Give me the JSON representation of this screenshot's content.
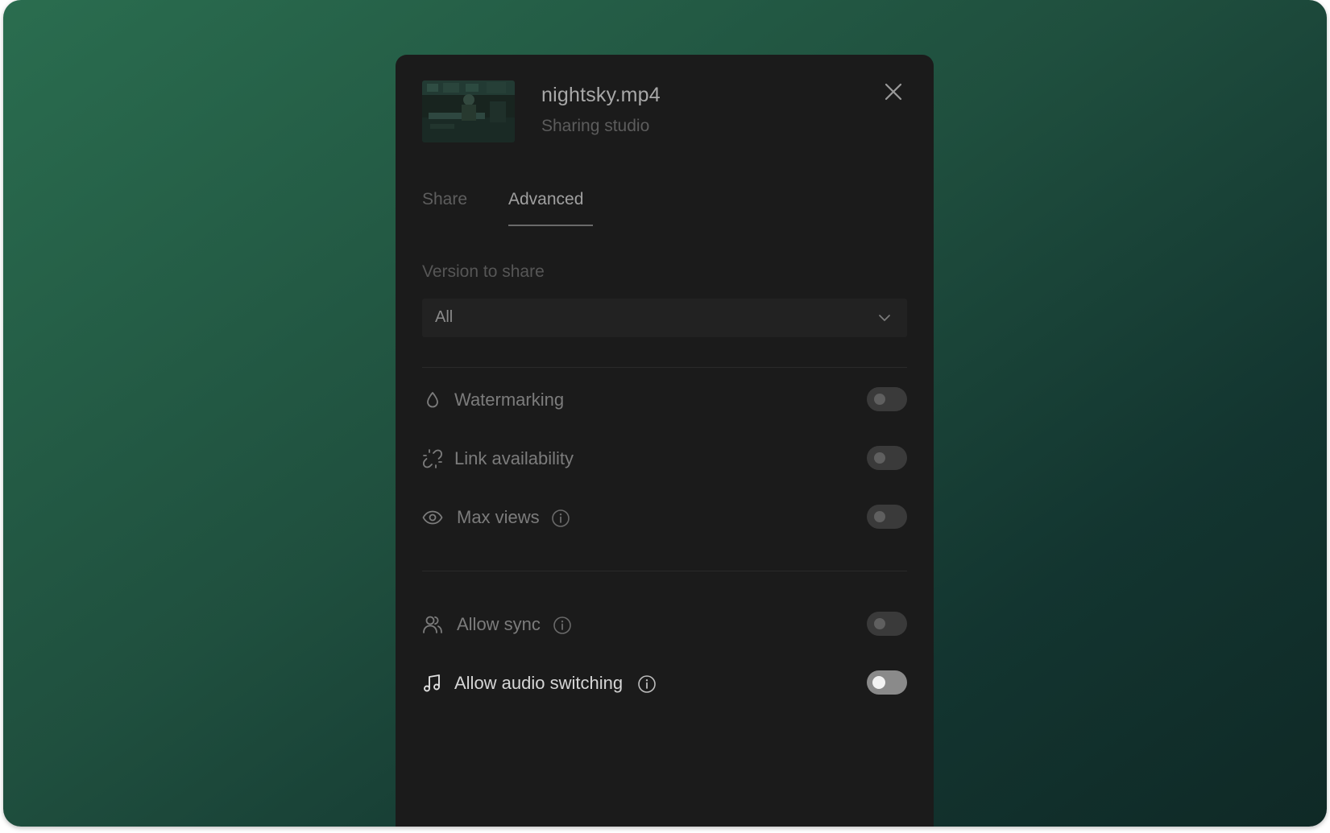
{
  "file": {
    "name": "nightsky.mp4",
    "subtitle": "Sharing studio"
  },
  "tabs": [
    {
      "label": "Share",
      "active": false
    },
    {
      "label": "Advanced",
      "active": true
    }
  ],
  "version": {
    "label": "Version to share",
    "selected": "All"
  },
  "settings_group_1": [
    {
      "label": "Watermarking",
      "icon": "droplet-icon",
      "info": false,
      "enabled": false
    },
    {
      "label": "Link availability",
      "icon": "broken-link-icon",
      "info": false,
      "enabled": false
    },
    {
      "label": "Max views",
      "icon": "eye-icon",
      "info": true,
      "enabled": false
    }
  ],
  "settings_group_2": [
    {
      "label": "Allow sync",
      "icon": "users-icon",
      "info": true,
      "enabled": false
    },
    {
      "label": "Allow audio switching",
      "icon": "music-note-icon",
      "info": true,
      "enabled": false
    }
  ],
  "colors": {
    "background_start": "#2a6d4f",
    "background_end": "#0f2926",
    "panel": "#1b1b1b"
  }
}
